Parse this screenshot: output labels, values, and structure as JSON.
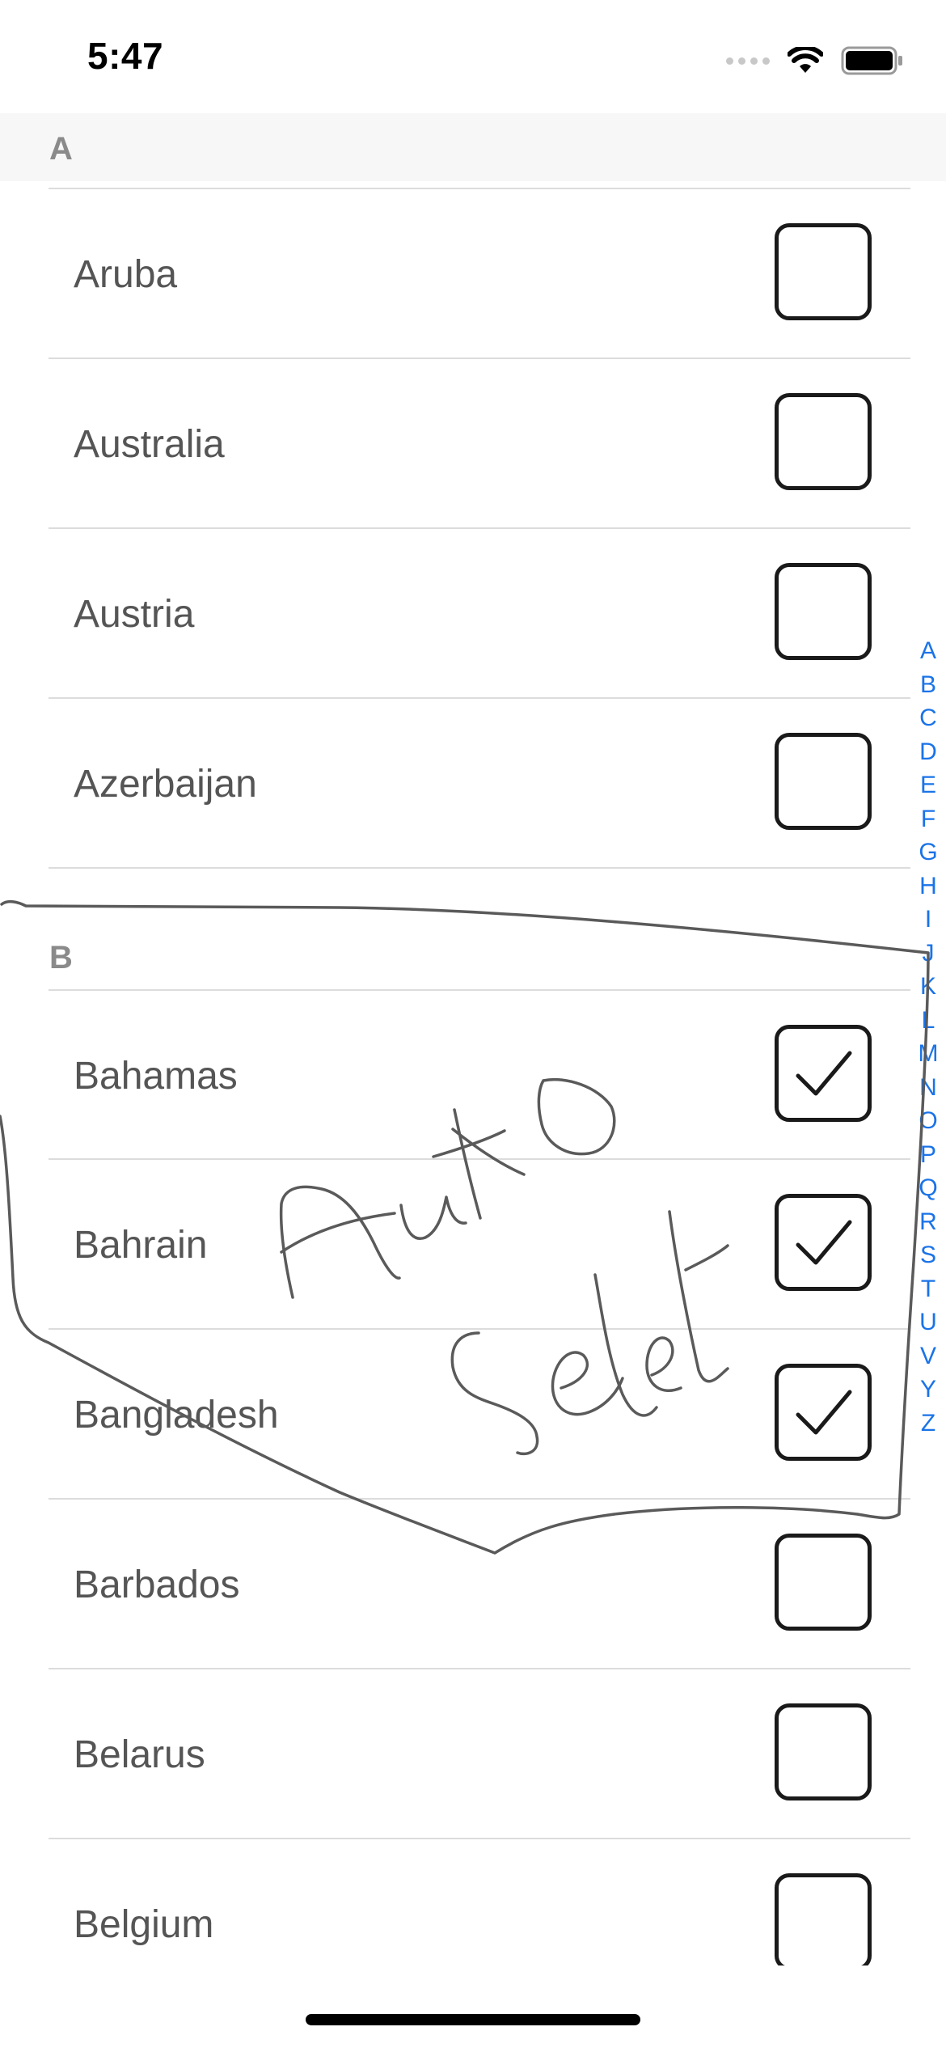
{
  "status_bar": {
    "time": "5:47"
  },
  "sections": [
    {
      "letter": "A",
      "countries": [
        {
          "name": "Aruba",
          "checked": false
        },
        {
          "name": "Australia",
          "checked": false
        },
        {
          "name": "Austria",
          "checked": false
        },
        {
          "name": "Azerbaijan",
          "checked": false
        }
      ]
    },
    {
      "letter": "B",
      "countries": [
        {
          "name": "Bahamas",
          "checked": true
        },
        {
          "name": "Bahrain",
          "checked": true
        },
        {
          "name": "Bangladesh",
          "checked": true
        },
        {
          "name": "Barbados",
          "checked": false
        },
        {
          "name": "Belarus",
          "checked": false
        },
        {
          "name": "Belgium",
          "checked": false
        }
      ]
    }
  ],
  "index_letters": [
    "A",
    "B",
    "C",
    "D",
    "E",
    "F",
    "G",
    "H",
    "I",
    "J",
    "K",
    "L",
    "M",
    "N",
    "O",
    "P",
    "Q",
    "R",
    "S",
    "T",
    "U",
    "V",
    "Y",
    "Z"
  ],
  "handwriting": {
    "text": "Auto Select"
  },
  "colors": {
    "index_accent": "#1a73e8",
    "section_header_bg": "#f7f7f7",
    "ink": "#5a5a5a"
  }
}
